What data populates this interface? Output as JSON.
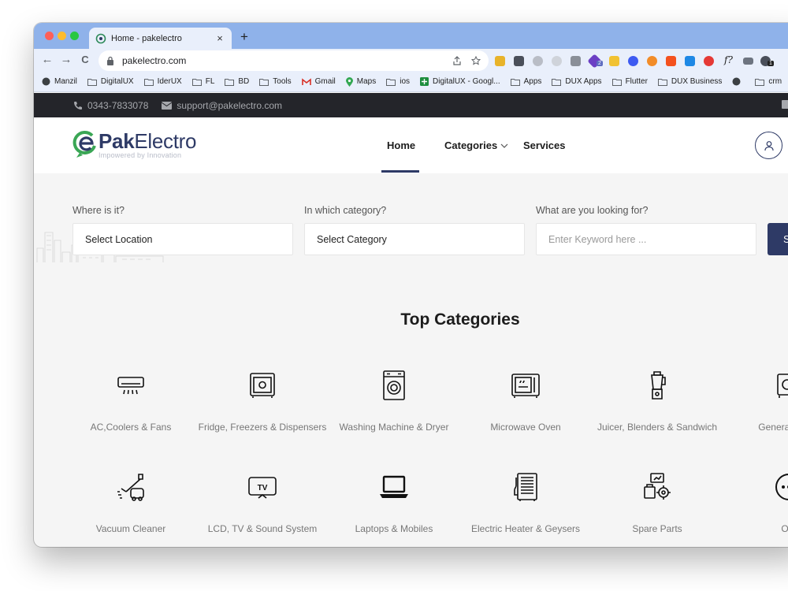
{
  "browser": {
    "tab_title": "Home - pakelectro",
    "tab_close": "×",
    "new_tab": "+",
    "back": "←",
    "forward": "→",
    "reload": "C",
    "url": "pakelectro.com",
    "ext_badge_1": "2",
    "ext_badge_2": "1",
    "ext_f": "f?"
  },
  "bookmarks": [
    "Manzil",
    "DigitalUX",
    "IderUX",
    "FL",
    "BD",
    "Tools",
    "Gmail",
    "Maps",
    "ios",
    "DigitalUX - Googl...",
    "Apps",
    "DUX Apps",
    "Flutter",
    "DUX Business",
    "crm"
  ],
  "topbar": {
    "phone": "0343-7833078",
    "email": "support@pakelectro.com"
  },
  "header": {
    "logo_bold": "Pak",
    "logo_light": "Electro",
    "tagline": "Impowered by Innovation",
    "nav_home": "Home",
    "nav_categories": "Categories",
    "nav_services": "Services"
  },
  "search": {
    "location_label": "Where is it?",
    "location_value": "Select Location",
    "category_label": "In which category?",
    "category_value": "Select Category",
    "keyword_label": "What are you looking for?",
    "keyword_placeholder": "Enter Keyword here ...",
    "button_label": "S"
  },
  "categories": {
    "title": "Top Categories",
    "items": [
      {
        "label": "AC,Coolers & Fans",
        "icon": "air-conditioner-icon"
      },
      {
        "label": "Fridge, Freezers & Dispensers",
        "icon": "fridge-icon"
      },
      {
        "label": "Washing Machine & Dryer",
        "icon": "washing-machine-icon"
      },
      {
        "label": "Microwave Oven",
        "icon": "microwave-icon"
      },
      {
        "label": "Juicer, Blenders & Sandwich",
        "icon": "blender-icon"
      },
      {
        "label": "Generato Solu",
        "icon": "generator-icon"
      },
      {
        "label": "Vacuum Cleaner",
        "icon": "vacuum-icon"
      },
      {
        "label": "LCD, TV & Sound System",
        "icon": "tv-icon"
      },
      {
        "label": "Laptops & Mobiles",
        "icon": "laptop-icon"
      },
      {
        "label": "Electric Heater & Geysers",
        "icon": "heater-icon"
      },
      {
        "label": "Spare Parts",
        "icon": "spare-parts-icon"
      },
      {
        "label": "Oth",
        "icon": "other-icon"
      }
    ]
  },
  "colors": {
    "brand": "#2e3a66",
    "topbar": "#24252a",
    "accent_green": "#3aa655"
  }
}
